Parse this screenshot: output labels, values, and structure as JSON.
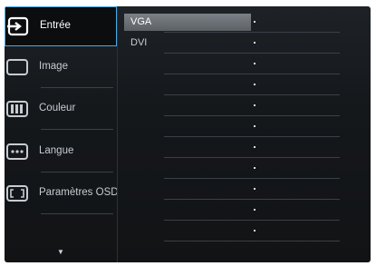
{
  "menu": {
    "items": [
      {
        "label": "Entrée",
        "icon": "input-icon",
        "selected": true
      },
      {
        "label": "Image",
        "icon": "picture-icon",
        "selected": false
      },
      {
        "label": "Couleur",
        "icon": "color-icon",
        "selected": false
      },
      {
        "label": "Langue",
        "icon": "language-icon",
        "selected": false
      },
      {
        "label": "Paramètres OSD",
        "icon": "osd-settings-icon",
        "selected": false
      }
    ],
    "more_icon": "scroll-down-arrow-icon"
  },
  "submenu": {
    "options": [
      "VGA",
      "DVI"
    ],
    "highlighted": "VGA"
  },
  "colors": {
    "selection_border": "#4aa8e8",
    "highlight_bar": "#6c7177"
  }
}
